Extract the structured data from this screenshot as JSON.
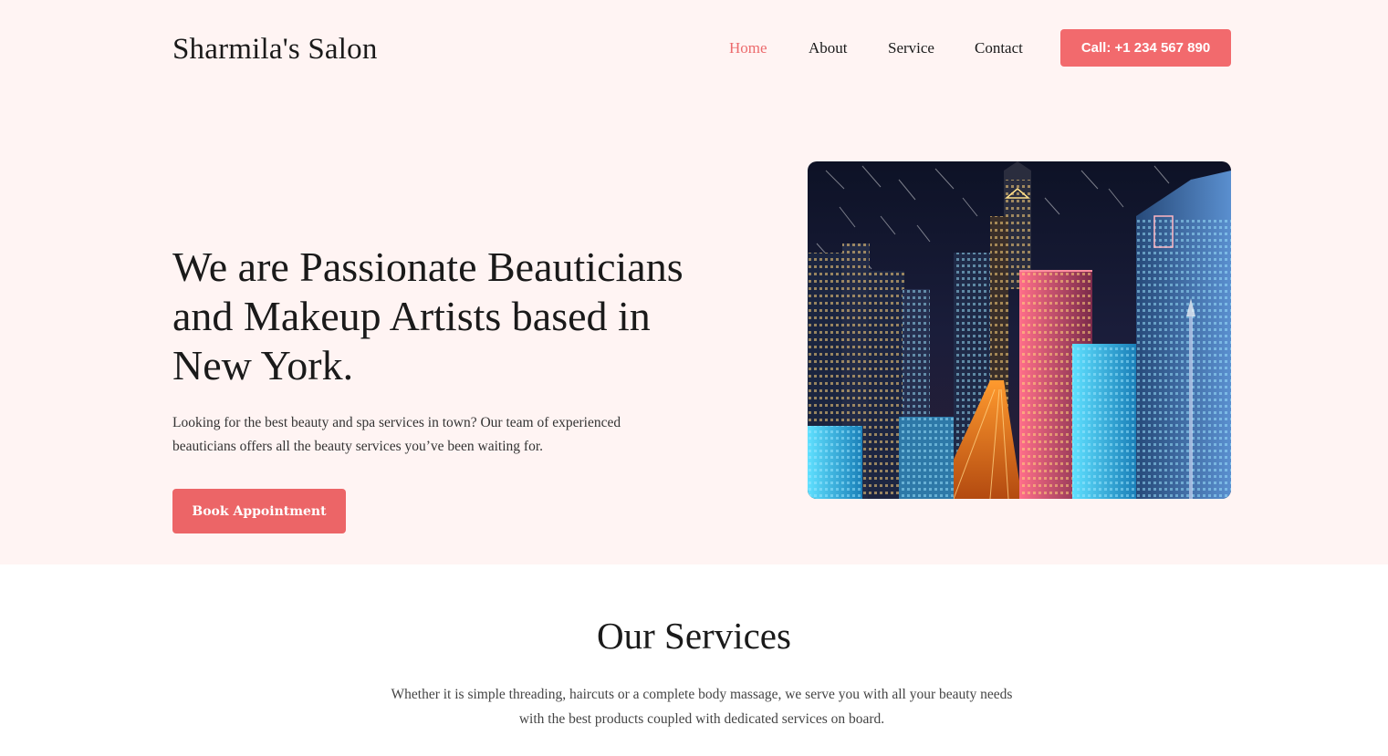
{
  "header": {
    "brand": "Sharmila's Salon",
    "nav": {
      "home": "Home",
      "about": "About",
      "service": "Service",
      "contact": "Contact",
      "active": "Home"
    },
    "call_button": "Call: +1 234 567 890"
  },
  "hero": {
    "title": "We are Passionate Beauticians and Makeup Artists based in New York.",
    "description": "Looking for the best beauty and spa services in town? Our team of experienced beauticians offers all the beauty services you’ve been waiting for.",
    "cta": "Book Appointment",
    "image_subject": "night-city-skyline-image"
  },
  "services": {
    "title": "Our Services",
    "description": "Whether it is simple threading, haircuts or a complete body massage, we serve you with all your beauty needs with the best products coupled with dedicated services on board."
  },
  "colors": {
    "hero_background": "#fff4f3",
    "accent": "#f26a6d",
    "nav_active": "#ec6a6c",
    "text": "#1a1a1a"
  }
}
